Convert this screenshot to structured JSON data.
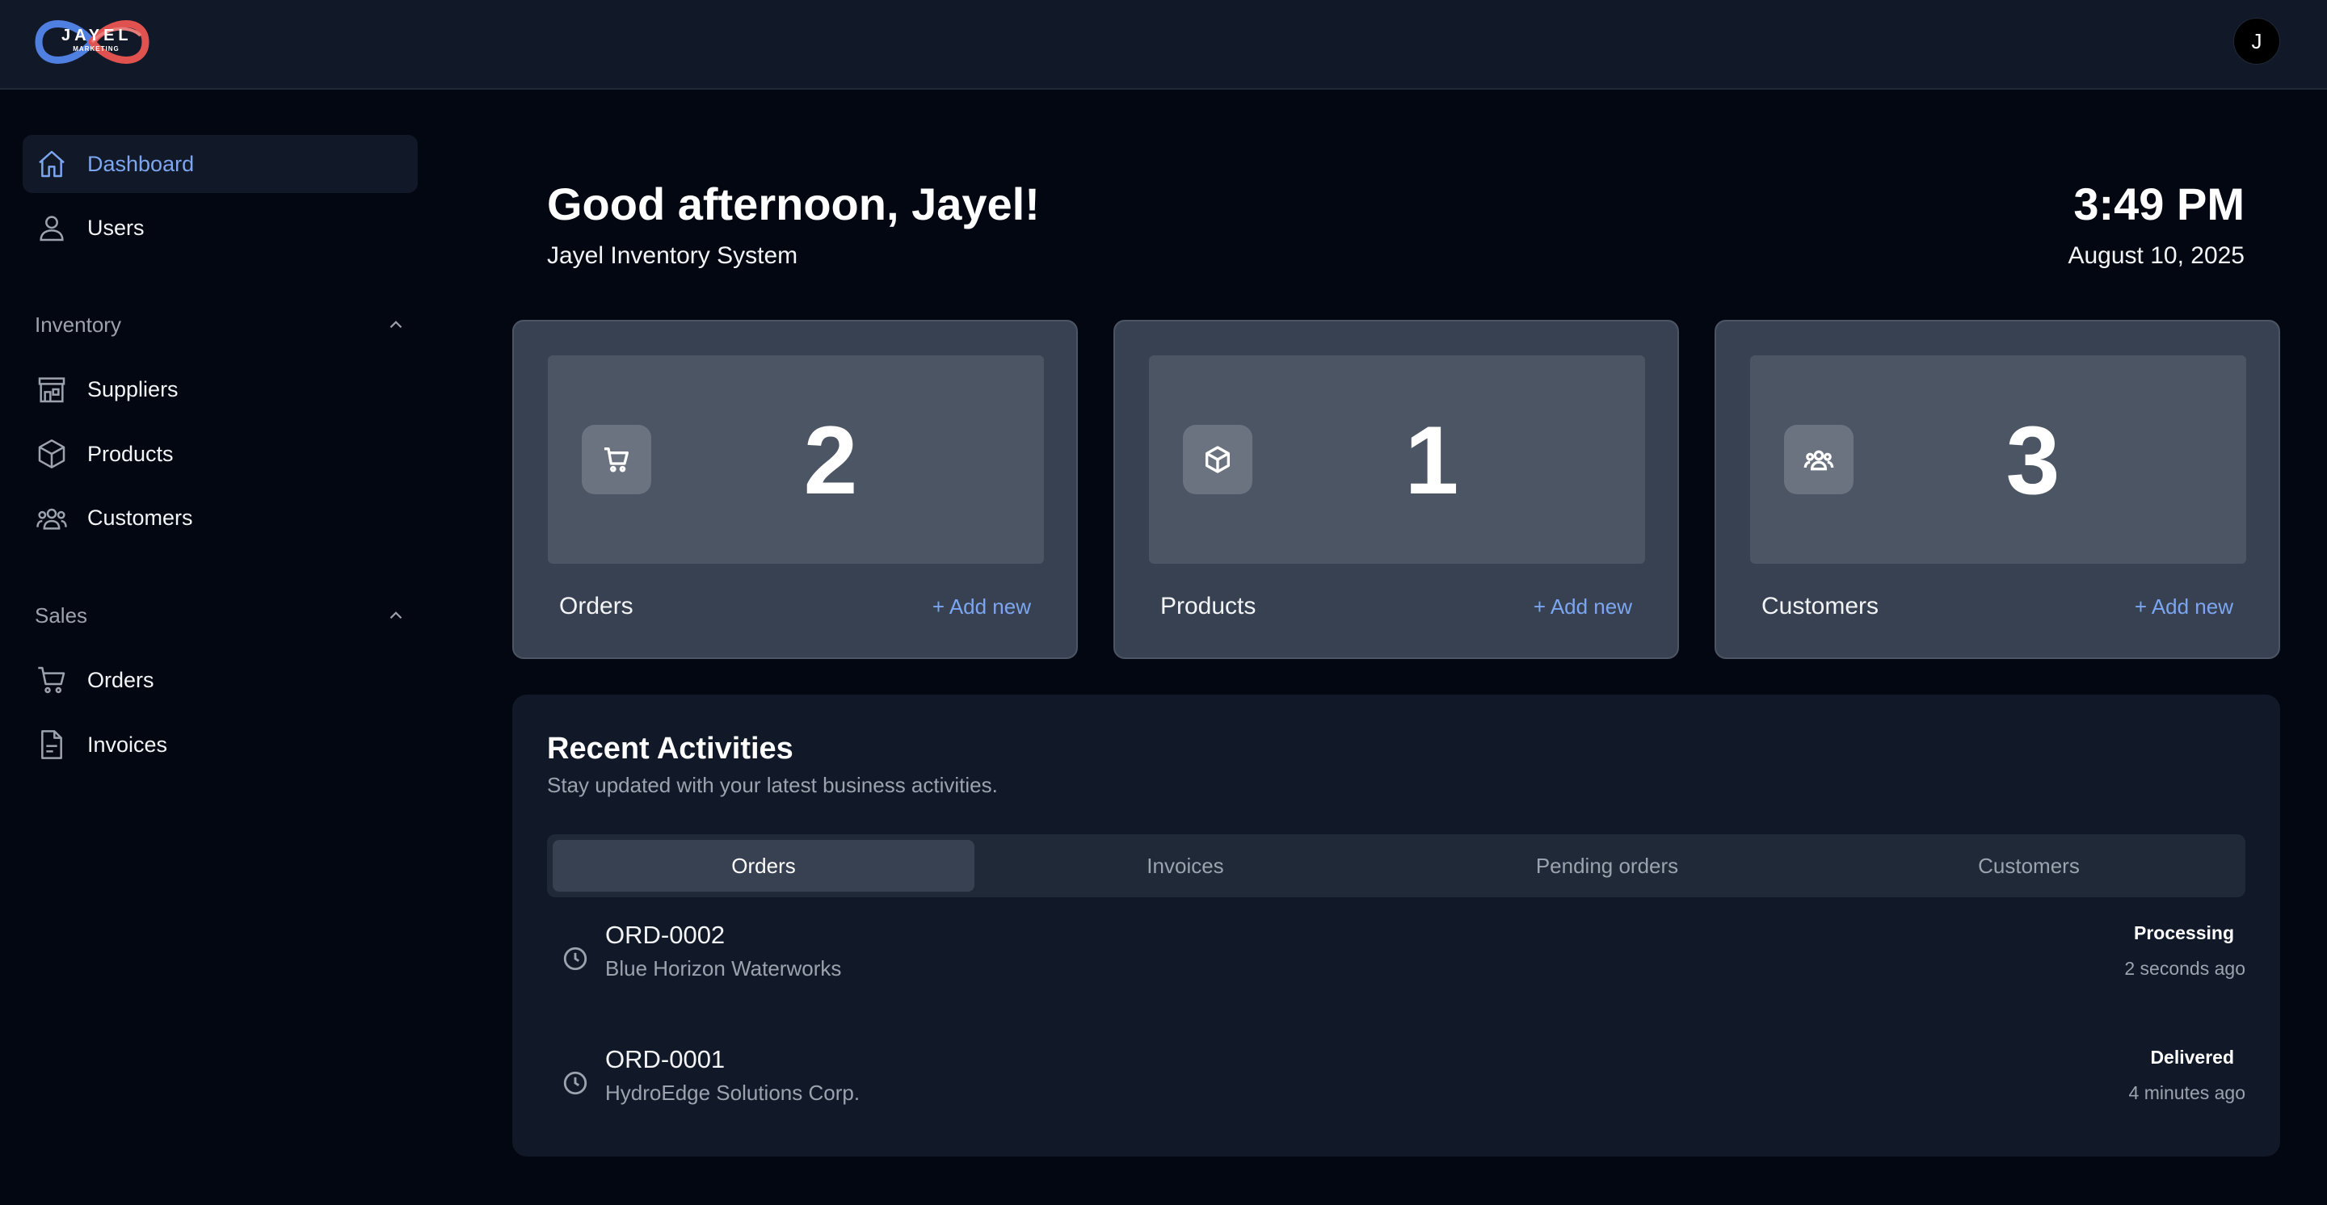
{
  "brand": {
    "logo_text": "JAYEL",
    "logo_subtext": "MARKETING"
  },
  "user": {
    "avatar_initial": "J"
  },
  "sidebar": {
    "top_items": [
      {
        "label": "Dashboard",
        "icon": "home-icon",
        "active": true
      },
      {
        "label": "Users",
        "icon": "user-icon",
        "active": false
      }
    ],
    "sections": [
      {
        "title": "Inventory",
        "expanded": true,
        "items": [
          {
            "label": "Suppliers",
            "icon": "store-icon"
          },
          {
            "label": "Products",
            "icon": "box-icon"
          },
          {
            "label": "Customers",
            "icon": "users-group-icon"
          }
        ]
      },
      {
        "title": "Sales",
        "expanded": true,
        "items": [
          {
            "label": "Orders",
            "icon": "cart-icon"
          },
          {
            "label": "Invoices",
            "icon": "file-icon"
          }
        ]
      }
    ]
  },
  "header": {
    "greeting": "Good afternoon, Jayel!",
    "subtitle": "Jayel Inventory System",
    "time": "3:49 PM",
    "date": "August 10, 2025"
  },
  "stats": [
    {
      "label": "Orders",
      "value": "2",
      "icon": "cart-icon",
      "action": "+ Add new"
    },
    {
      "label": "Products",
      "value": "1",
      "icon": "box-icon",
      "action": "+ Add new"
    },
    {
      "label": "Customers",
      "value": "3",
      "icon": "users-group-icon",
      "action": "+ Add new"
    }
  ],
  "activities": {
    "title": "Recent Activities",
    "subtitle": "Stay updated with your latest business activities.",
    "tabs": [
      "Orders",
      "Invoices",
      "Pending orders",
      "Customers"
    ],
    "active_tab": "Orders",
    "rows": [
      {
        "id": "ORD-0002",
        "customer": "Blue Horizon Waterworks",
        "status": "Processing",
        "time": "2 seconds ago",
        "icon": "clock-icon"
      },
      {
        "id": "ORD-0001",
        "customer": "HydroEdge Solutions Corp.",
        "status": "Delivered",
        "time": "4 minutes ago",
        "icon": "clock-icon"
      }
    ]
  },
  "colors": {
    "background": "#030712",
    "panel": "#111827",
    "card": "#374151",
    "accent": "#7ca6f0"
  }
}
